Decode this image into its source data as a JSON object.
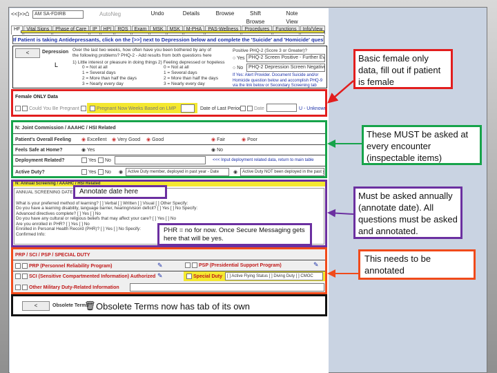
{
  "toolbar": {
    "nav": "<<|>>",
    "patient": "AM SA-FDIRB",
    "autoneg": "AutoNeg",
    "undo": "Undo",
    "details": "Details",
    "browse": "Browse",
    "shift_browse": "Shift Browse",
    "note_view": "Note View"
  },
  "tabs": [
    "HF",
    "Vital Signs",
    "Phase of Care",
    "IP",
    "HPI",
    "ROS",
    "Exam",
    "MSK",
    "MSK",
    "M-PHA",
    "PAS-Wellness",
    "Procedures",
    "Functions",
    "Info/View"
  ],
  "instruction": "If Patient is taking Antidepressants, click on the [>>] next to Depression below and complete the 'Suicide' and 'Homicide' questions",
  "depression": {
    "button": "<",
    "label": "Depression",
    "question": "Over the last two weeks, how often have you been bothered by any of the following problems? PHQ-2 - Add results from both questions here",
    "marker": "L",
    "q1": "1) Little interest or pleasure in doing things",
    "q2": "2) Feeling depressed or hopeless",
    "scale": [
      "0 = Not at all",
      "1 = Several days",
      "2 = More than half the days",
      "3 = Nearly every day"
    ],
    "positive_label": "Positive PHQ-2 (Score 3 or Greater)?",
    "yes": "Yes",
    "yes_value": "PHQ-2 Screen Positive - Further Evaluation",
    "no": "No",
    "no_value": "PHQ-2 Depression Screen Negative.",
    "note": "If Yes: Alert Provider. Document Suicide and/or Homicide question below and accomplish PHQ-9 via the link below or Secondary Screening tab"
  },
  "female": {
    "title": "Female ONLY Data",
    "could_be_pregnant": "Could You Be Pregnant",
    "pregnant_now": "Pregnant Now",
    "weeks": "Weeks Based on LMP",
    "last_period": "Date of Last Period",
    "date": "Date",
    "unknown": "U - Unknown"
  },
  "joint": {
    "title": "N: Joint Commission / AAAHC / HSI Related",
    "feeling_label": "Patient's Overall Feeling",
    "feelings": [
      "Excellent",
      "Very Good",
      "Good",
      "Fair",
      "Poor"
    ],
    "safe_label": "Feels Safe at Home?",
    "safe_yes": "Yes",
    "safe_no": "No",
    "deploy_label": "Deployment Related?",
    "yes": "Yes",
    "no": "No",
    "deploy_note": "<<< Input deployment related data, return to main table",
    "active_label": "Active Duty?",
    "active_opt1": "Active Duty member, deployed in past year - Date",
    "active_opt2": "Active Duty NOT been deployed in the past year"
  },
  "annual": {
    "header": "N: Annual Screening / AAAHC / HSI Related",
    "title": "ANNUAL SCREENING DATE:",
    "lines": [
      "What is your preferred method of learning? [ ] Verbal [ ] Written [ ] Visual [ ] Other Specify:",
      "Do you have a learning disability, language barrier, hearing/vision deficit? [ ] Yes [ ] No Specify:",
      "Advanced directives complete? [ ] Yes [ ] No",
      "Do you have any cultural or religious beliefs that may affect your care? [ ] Yes [ ] No",
      "Are you enrolled in PHR? [ ] Yes [ ] No",
      "Enrolled in Personal Health Record (PHR)? [ ] Yes [ ] No Specify:",
      "Confirmed Info:"
    ]
  },
  "duty": {
    "title": "PRP / SCI / PSP / SPECIAL DUTY",
    "prp": "PRP (Personnel Reliability Program)",
    "psp": "PSP (Presidential Support Program)",
    "sci": "SCI (Sensitive Compartmented Information) Authorized",
    "special": "Special Duty",
    "special_value": "[ ] Active Flying Status [ ] Diving Duty [ ] CMOC",
    "other": "Other Military Duty-Related Information"
  },
  "obsolete": {
    "button": "<",
    "label": "Obsolete Terms",
    "note": "Obsolete Terms now has tab of its own"
  },
  "annotations": {
    "female": "Basic female only data, fill out if patient is female",
    "joint": "These MUST be asked at every encounter (inspectable items)",
    "annual": "Must be asked annually (annotate date).  All questions must be asked and annotated.",
    "annual_date": "Annotate date here",
    "phr": "PHR = no for now.  Once Secure Messaging gets here that will be yes.",
    "duty": "This needs to be annotated"
  },
  "colors": {
    "red": "#e21d1d",
    "green": "#16a34a",
    "purple": "#6b2fa0",
    "orange": "#f04a1a",
    "yellow": "#f4e830"
  }
}
